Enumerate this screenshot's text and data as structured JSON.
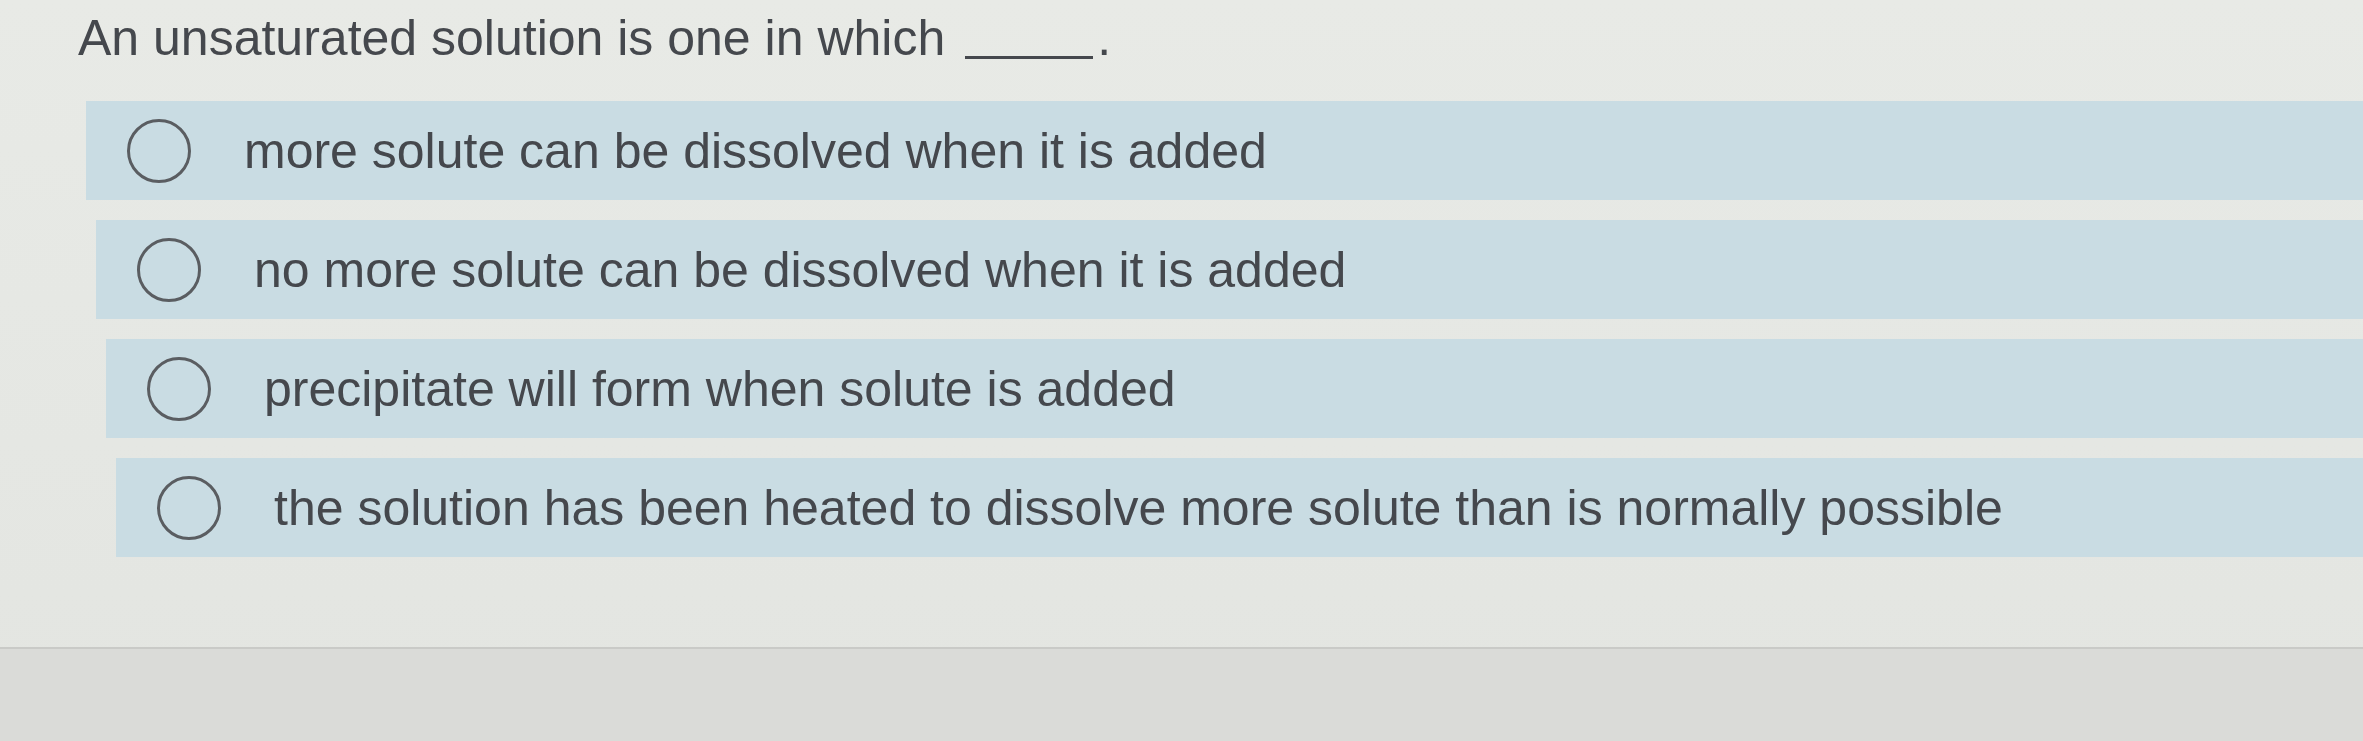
{
  "question": {
    "text": "An unsaturated solution is one in which",
    "after_blank": "."
  },
  "options": [
    {
      "label": "more solute can be dissolved when it is added",
      "selected": false
    },
    {
      "label": "no more solute can be dissolved when it is added",
      "selected": false
    },
    {
      "label": "precipitate will form when solute is added",
      "selected": false
    },
    {
      "label": "the solution has been heated to dissolve more solute than is normally possible",
      "selected": false
    }
  ]
}
